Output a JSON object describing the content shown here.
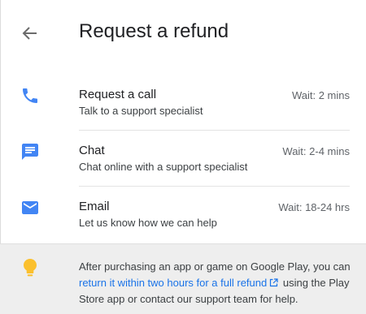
{
  "header": {
    "title": "Request a refund",
    "back_icon": "arrow-back-icon"
  },
  "options": [
    {
      "icon": "phone-icon",
      "title": "Request a call",
      "subtitle": "Talk to a support specialist",
      "wait": "Wait: 2 mins"
    },
    {
      "icon": "chat-icon",
      "title": "Chat",
      "subtitle": "Chat online with a support specialist",
      "wait": "Wait: 2-4 mins"
    },
    {
      "icon": "email-icon",
      "title": "Email",
      "subtitle": "Let us know how we can help",
      "wait": "Wait: 18-24 hrs"
    }
  ],
  "tip": {
    "icon": "lightbulb-icon",
    "text_before": "After purchasing an app or game on Google Play, you can",
    "link_text": "return it within two hours for a full refund",
    "link_icon": "external-link-icon",
    "text_after": "using the Play Store app or contact our support team for help."
  },
  "colors": {
    "accent": "#4285f4",
    "link": "#1a73e8",
    "bulb": "#fbc02d",
    "tip_background": "#eeeeee"
  }
}
